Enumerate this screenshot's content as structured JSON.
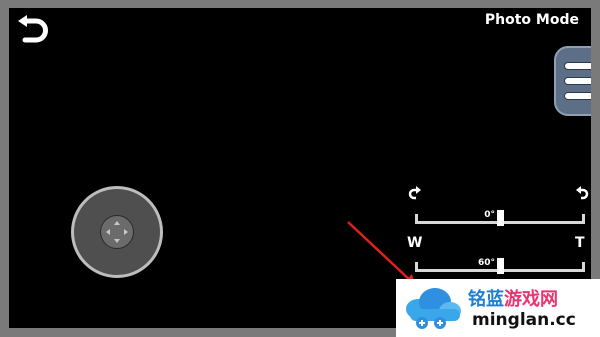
{
  "header": {
    "mode_label": "Photo Mode",
    "back_icon": "back-arrow-icon",
    "menu_icon": "hamburger-menu-icon"
  },
  "joystick": {
    "icon": "dpad-arrows-icon"
  },
  "rotation_slider": {
    "left_icon": "rotate-clockwise-icon",
    "right_icon": "rotate-counterclockwise-icon",
    "value_label": "0°",
    "level": 0.5
  },
  "zoom_slider": {
    "left_label": "W",
    "right_label": "T",
    "value_label": "60°",
    "level": 0.5
  },
  "watermark": {
    "title_part1": "铭蓝",
    "title_part2": "游戏网",
    "url": "minglan.cc"
  },
  "colors": {
    "background": "#000000",
    "border": "#7a7a7a",
    "menu_button": "#5d6f86",
    "pointer_arrow": "#e0201a",
    "watermark_blue": "#1d7fd6",
    "watermark_pink": "#e8356f"
  }
}
